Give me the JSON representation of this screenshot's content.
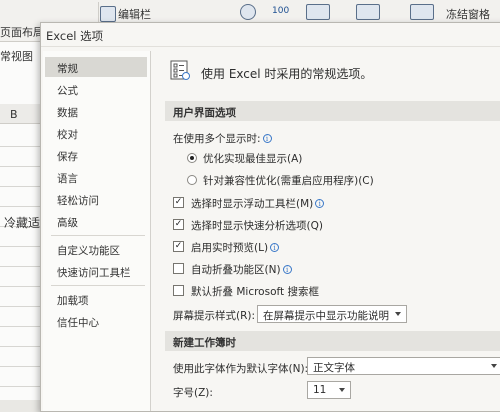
{
  "background": {
    "ribbon": {
      "view_label": "页面布局",
      "edit_bar_label": "编辑栏",
      "freeze_label": "冻结窗格",
      "icon_label": "100"
    },
    "sheet": {
      "tab_label": "常视图",
      "column_letter": "B",
      "cell_text": "冷藏适"
    }
  },
  "dialog": {
    "title": "Excel 选项",
    "nav": [
      {
        "label": "常规",
        "selected": true
      },
      {
        "label": "公式"
      },
      {
        "label": "数据"
      },
      {
        "label": "校对"
      },
      {
        "label": "保存"
      },
      {
        "label": "语言"
      },
      {
        "label": "轻松访问"
      },
      {
        "label": "高级"
      },
      {
        "label": "自定义功能区"
      },
      {
        "label": "快速访问工具栏"
      },
      {
        "label": "加载项"
      },
      {
        "label": "信任中心"
      }
    ],
    "header_text": "使用 Excel 时采用的常规选项。",
    "ui_section": {
      "title": "用户界面选项",
      "multi_display_label": "在使用多个显示时:",
      "radio_best": "优化实现最佳显示(A)",
      "radio_compat": "针对兼容性优化(需重启应用程序)(C)",
      "cb_mini_toolbar": "选择时显示浮动工具栏(M)",
      "cb_quick_analysis": "选择时显示快速分析选项(Q)",
      "cb_live_preview": "启用实时预览(L)",
      "cb_collapse_ribbon": "自动折叠功能区(N)",
      "cb_collapse_search": "默认折叠 Microsoft 搜索框",
      "screentip_label": "屏幕提示样式(R):",
      "screentip_value": "在屏幕提示中显示功能说明"
    },
    "new_wb_section": {
      "title": "新建工作簿时",
      "default_font_label": "使用此字体作为默认字体(N):",
      "default_font_value": "正文字体",
      "font_size_label": "字号(Z):",
      "font_size_value": "11"
    }
  },
  "colors": {
    "info_icon": "#3a78c8",
    "selected_nav": "#d9d8d3",
    "section_bar": "#e4e3df"
  }
}
